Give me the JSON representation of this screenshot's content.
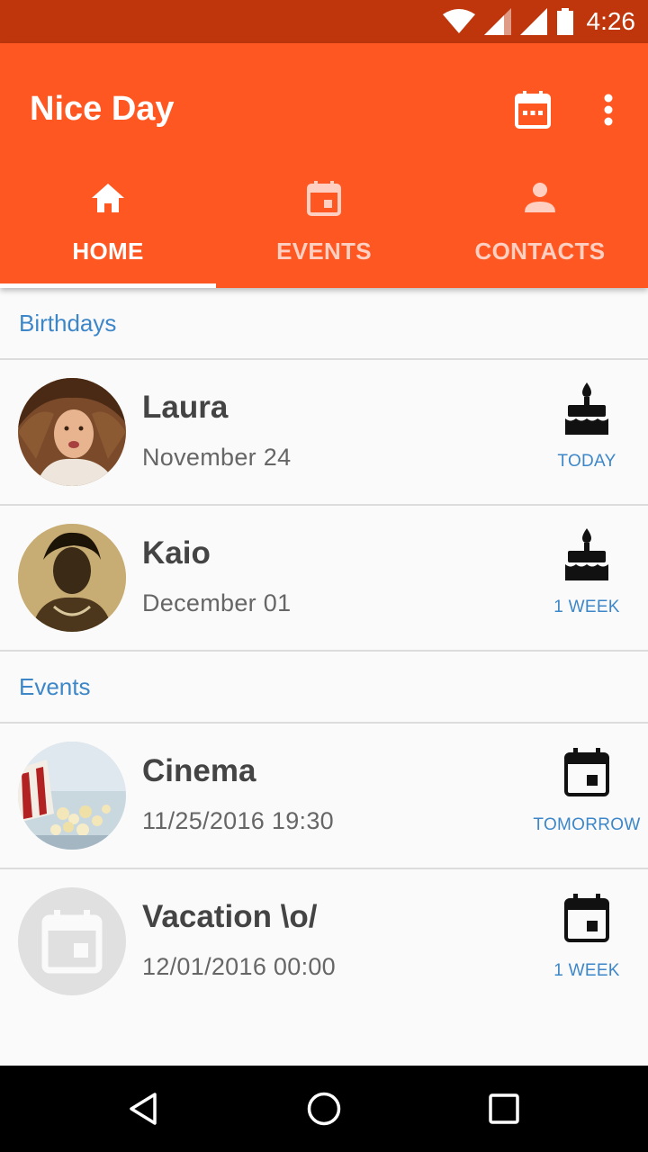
{
  "status_bar": {
    "time": "4:26",
    "icons": [
      "wifi-icon",
      "cell-signal-icon",
      "cell-signal-icon",
      "battery-icon"
    ]
  },
  "app_bar": {
    "title": "Nice Day",
    "actions": [
      "calendar-icon",
      "more-vert-icon"
    ],
    "color": "#ff5722"
  },
  "tabs": [
    {
      "label": "HOME",
      "icon": "home-icon",
      "selected": true
    },
    {
      "label": "EVENTS",
      "icon": "event-icon",
      "selected": false
    },
    {
      "label": "CONTACTS",
      "icon": "person-icon",
      "selected": false
    }
  ],
  "sections": {
    "birthdays": {
      "title": "Birthdays",
      "items": [
        {
          "name": "Laura",
          "date": "November 24",
          "badge": "TODAY",
          "icon": "cake-icon"
        },
        {
          "name": "Kaio",
          "date": "December 01",
          "badge": "1 WEEK",
          "icon": "cake-icon"
        }
      ]
    },
    "events": {
      "title": "Events",
      "items": [
        {
          "name": "Cinema",
          "date": "11/25/2016 19:30",
          "badge": "TOMORROW",
          "icon": "event-icon"
        },
        {
          "name": "Vacation \\o/",
          "date": "12/01/2016 00:00",
          "badge": "1 WEEK",
          "icon": "event-icon"
        }
      ]
    }
  },
  "colors": {
    "status_bar": "#bf360c",
    "accent_text": "#3d87c9"
  },
  "nav_bar": {
    "buttons": [
      "back-icon",
      "home-circle-icon",
      "recents-icon"
    ]
  }
}
